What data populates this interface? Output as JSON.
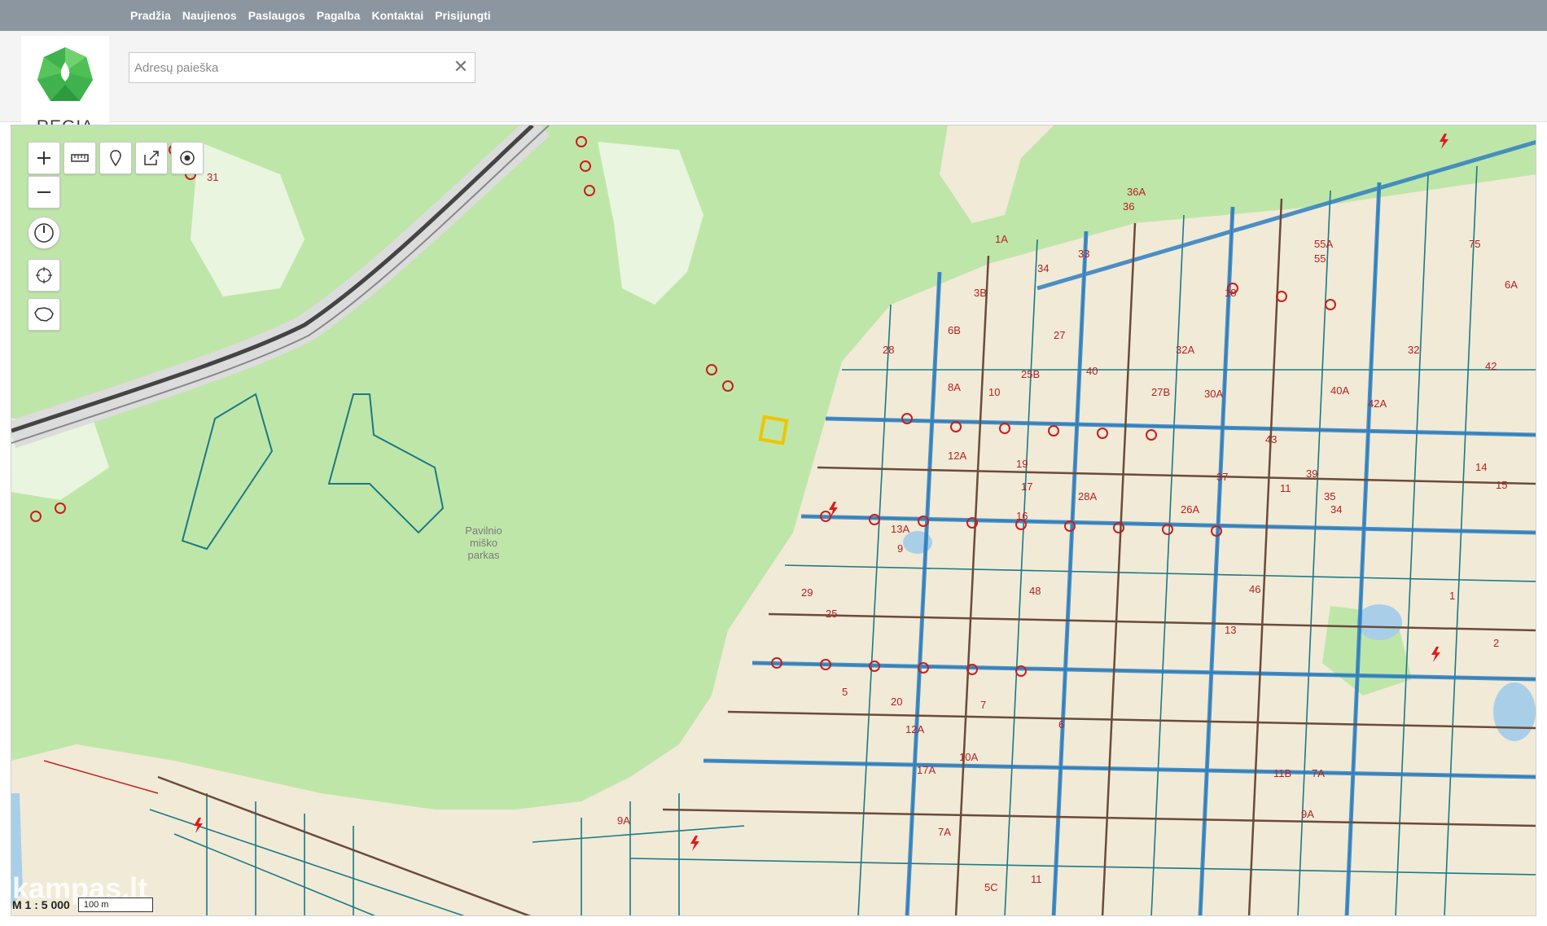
{
  "nav": {
    "items": [
      "Pradžia",
      "Naujienos",
      "Paslaugos",
      "Pagalba",
      "Kontaktai",
      "Prisijungti"
    ]
  },
  "logo": {
    "wordmark": "REGIA"
  },
  "search": {
    "placeholder": "Adresų paieška",
    "clear_icon": "close-icon"
  },
  "map": {
    "park_label": [
      "Pavilnio",
      "miško",
      "parkas"
    ],
    "scale_label": "M 1 : 5 000",
    "scale_value": "100 m",
    "watermark": "kampas.lt",
    "colors": {
      "greenery": "#bfe6a9",
      "built": "#f1ead7",
      "parcel": "#1a7a83",
      "road": "#2f7fc2",
      "utility": "#c81e1e"
    },
    "house_numbers": [
      "31",
      "36A",
      "36",
      "1A",
      "34",
      "33",
      "55A",
      "55",
      "6A",
      "75",
      "3B",
      "18",
      "6B",
      "27",
      "32A",
      "32",
      "42",
      "28",
      "25B",
      "40",
      "40A",
      "42A",
      "8A",
      "10",
      "27B",
      "30A",
      "43",
      "12A",
      "19",
      "17",
      "28A",
      "26A",
      "37",
      "39",
      "35",
      "34",
      "11",
      "14",
      "15",
      "16",
      "13A",
      "9",
      "29",
      "25",
      "48",
      "46",
      "13",
      "1",
      "2",
      "7",
      "6",
      "12A",
      "10A",
      "5",
      "20",
      "17A",
      "5C",
      "9A",
      "7A",
      "11",
      "11B",
      "7A",
      "9A"
    ]
  }
}
